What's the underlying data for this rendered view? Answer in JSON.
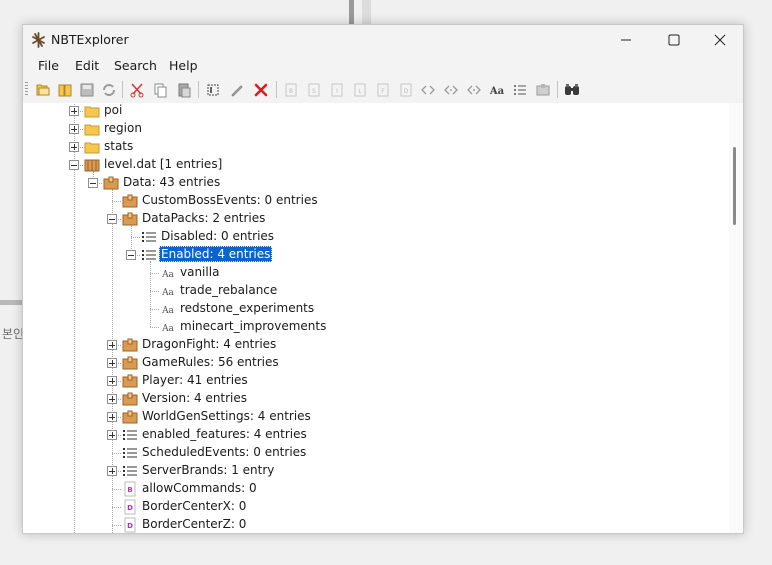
{
  "window": {
    "title": "NBTExplorer"
  },
  "menu": [
    "File",
    "Edit",
    "Search",
    "Help"
  ],
  "toolbar": [
    "open-icon",
    "open-folder-icon",
    "save-icon",
    "refresh-icon",
    "cut-icon",
    "copy-icon",
    "paste-icon",
    "rename-icon",
    "edit-value-icon",
    "delete-icon",
    "add-byte-icon",
    "add-short-icon",
    "add-int-icon",
    "add-long-icon",
    "add-float-icon",
    "add-double-icon",
    "add-byte-array-icon",
    "add-int-array-icon",
    "add-long-array-icon",
    "add-string-icon",
    "add-list-icon",
    "add-compound-icon",
    "find-icon"
  ],
  "background": {
    "fragment_text": "본인"
  },
  "tree": [
    {
      "label": "poi",
      "icon": "folder",
      "depth": 0,
      "expander": "plus"
    },
    {
      "label": "region",
      "icon": "folder",
      "depth": 0,
      "expander": "plus"
    },
    {
      "label": "stats",
      "icon": "folder",
      "depth": 0,
      "expander": "plus"
    },
    {
      "label": "level.dat [1 entries]",
      "icon": "nbt-file",
      "depth": 0,
      "expander": "minus"
    },
    {
      "label": "Data: 43 entries",
      "icon": "compound",
      "depth": 1,
      "expander": "minus"
    },
    {
      "label": "CustomBossEvents: 0 entries",
      "icon": "compound",
      "depth": 2,
      "expander": "none"
    },
    {
      "label": "DataPacks: 2 entries",
      "icon": "compound",
      "depth": 2,
      "expander": "minus"
    },
    {
      "label": "Disabled: 0 entries",
      "icon": "list",
      "depth": 3,
      "expander": "none"
    },
    {
      "label": "Enabled: 4 entries",
      "icon": "list",
      "depth": 3,
      "expander": "minus",
      "selected": true
    },
    {
      "label": "vanilla",
      "icon": "string",
      "depth": 4,
      "expander": "none"
    },
    {
      "label": "trade_rebalance",
      "icon": "string",
      "depth": 4,
      "expander": "none"
    },
    {
      "label": "redstone_experiments",
      "icon": "string",
      "depth": 4,
      "expander": "none"
    },
    {
      "label": "minecart_improvements",
      "icon": "string",
      "depth": 4,
      "expander": "none"
    },
    {
      "label": "DragonFight: 4 entries",
      "icon": "compound",
      "depth": 2,
      "expander": "plus"
    },
    {
      "label": "GameRules: 56 entries",
      "icon": "compound",
      "depth": 2,
      "expander": "plus"
    },
    {
      "label": "Player: 41 entries",
      "icon": "compound",
      "depth": 2,
      "expander": "plus"
    },
    {
      "label": "Version: 4 entries",
      "icon": "compound",
      "depth": 2,
      "expander": "plus"
    },
    {
      "label": "WorldGenSettings: 4 entries",
      "icon": "compound",
      "depth": 2,
      "expander": "plus"
    },
    {
      "label": "enabled_features: 4 entries",
      "icon": "list",
      "depth": 2,
      "expander": "plus"
    },
    {
      "label": "ScheduledEvents: 0 entries",
      "icon": "list",
      "depth": 2,
      "expander": "none"
    },
    {
      "label": "ServerBrands: 1 entry",
      "icon": "list",
      "depth": 2,
      "expander": "plus"
    },
    {
      "label": "allowCommands: 0",
      "icon": "byte",
      "depth": 2,
      "expander": "none"
    },
    {
      "label": "BorderCenterX: 0",
      "icon": "double",
      "depth": 2,
      "expander": "none"
    },
    {
      "label": "BorderCenterZ: 0",
      "icon": "double",
      "depth": 2,
      "expander": "none"
    }
  ],
  "colors": {
    "selection": "#0a64d0",
    "folder": "#f5c74f",
    "compound": "#d99a52",
    "delete": "#d91e1e",
    "cut": "#d23c3c"
  }
}
